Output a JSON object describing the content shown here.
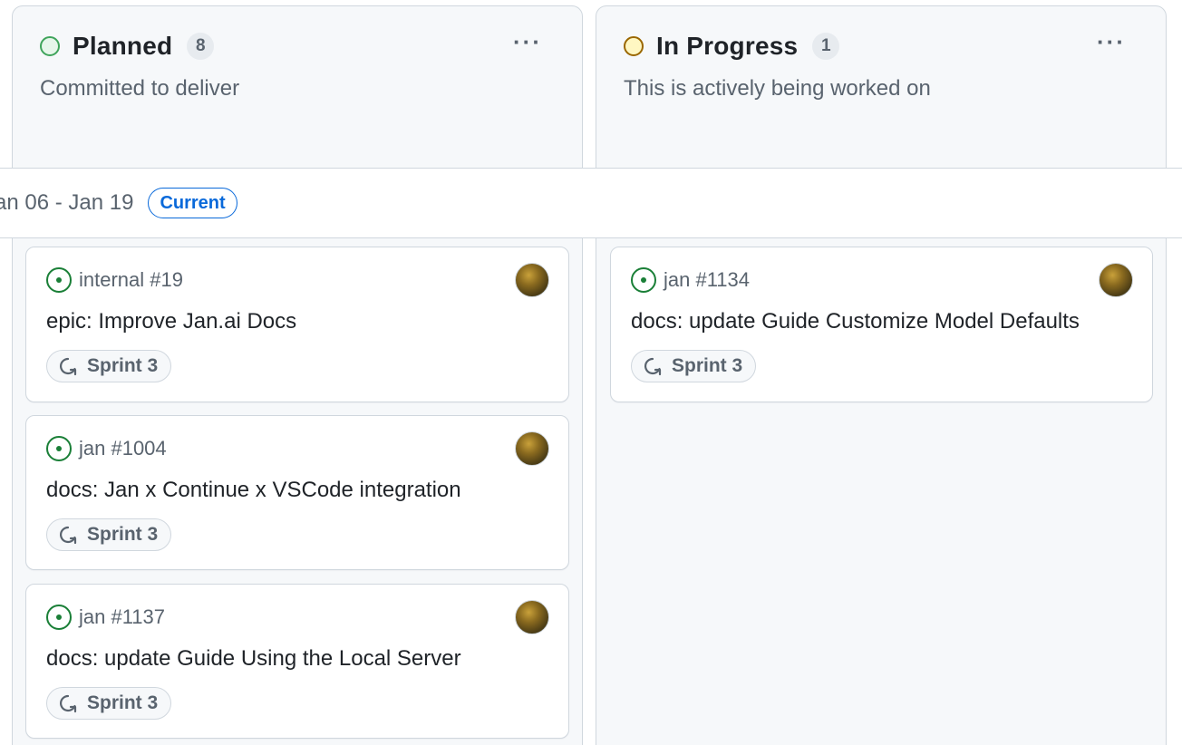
{
  "columns": [
    {
      "title": "Planned",
      "count": "8",
      "description": "Committed to deliver",
      "more": "···",
      "cards": [
        {
          "ref": "internal #19",
          "title": "epic: Improve Jan.ai Docs",
          "sprint": "Sprint 3"
        },
        {
          "ref": "jan #1004",
          "title": "docs: Jan x Continue x VSCode integration",
          "sprint": "Sprint 3"
        },
        {
          "ref": "jan #1137",
          "title": "docs: update Guide Using the Local Server",
          "sprint": "Sprint 3"
        }
      ]
    },
    {
      "title": "In Progress",
      "count": "1",
      "description": "This is actively being worked on",
      "more": "···",
      "cards": [
        {
          "ref": "jan #1134",
          "title": "docs: update Guide Customize Model Defaults",
          "sprint": "Sprint 3"
        }
      ]
    }
  ],
  "iteration": {
    "range": "an 06 - Jan 19",
    "badge": "Current"
  },
  "icons": {
    "planned_status": "circle-outline-green",
    "progress_status": "circle-outline-yellow",
    "issue": "issue-opened-icon",
    "sprint": "iterations-icon",
    "more": "kebab-horizontal-icon"
  },
  "colors": {
    "open_issue": "#1a7f37",
    "current_badge": "#0969da",
    "planned": "#3fa45b",
    "in_progress": "#9a6700"
  }
}
